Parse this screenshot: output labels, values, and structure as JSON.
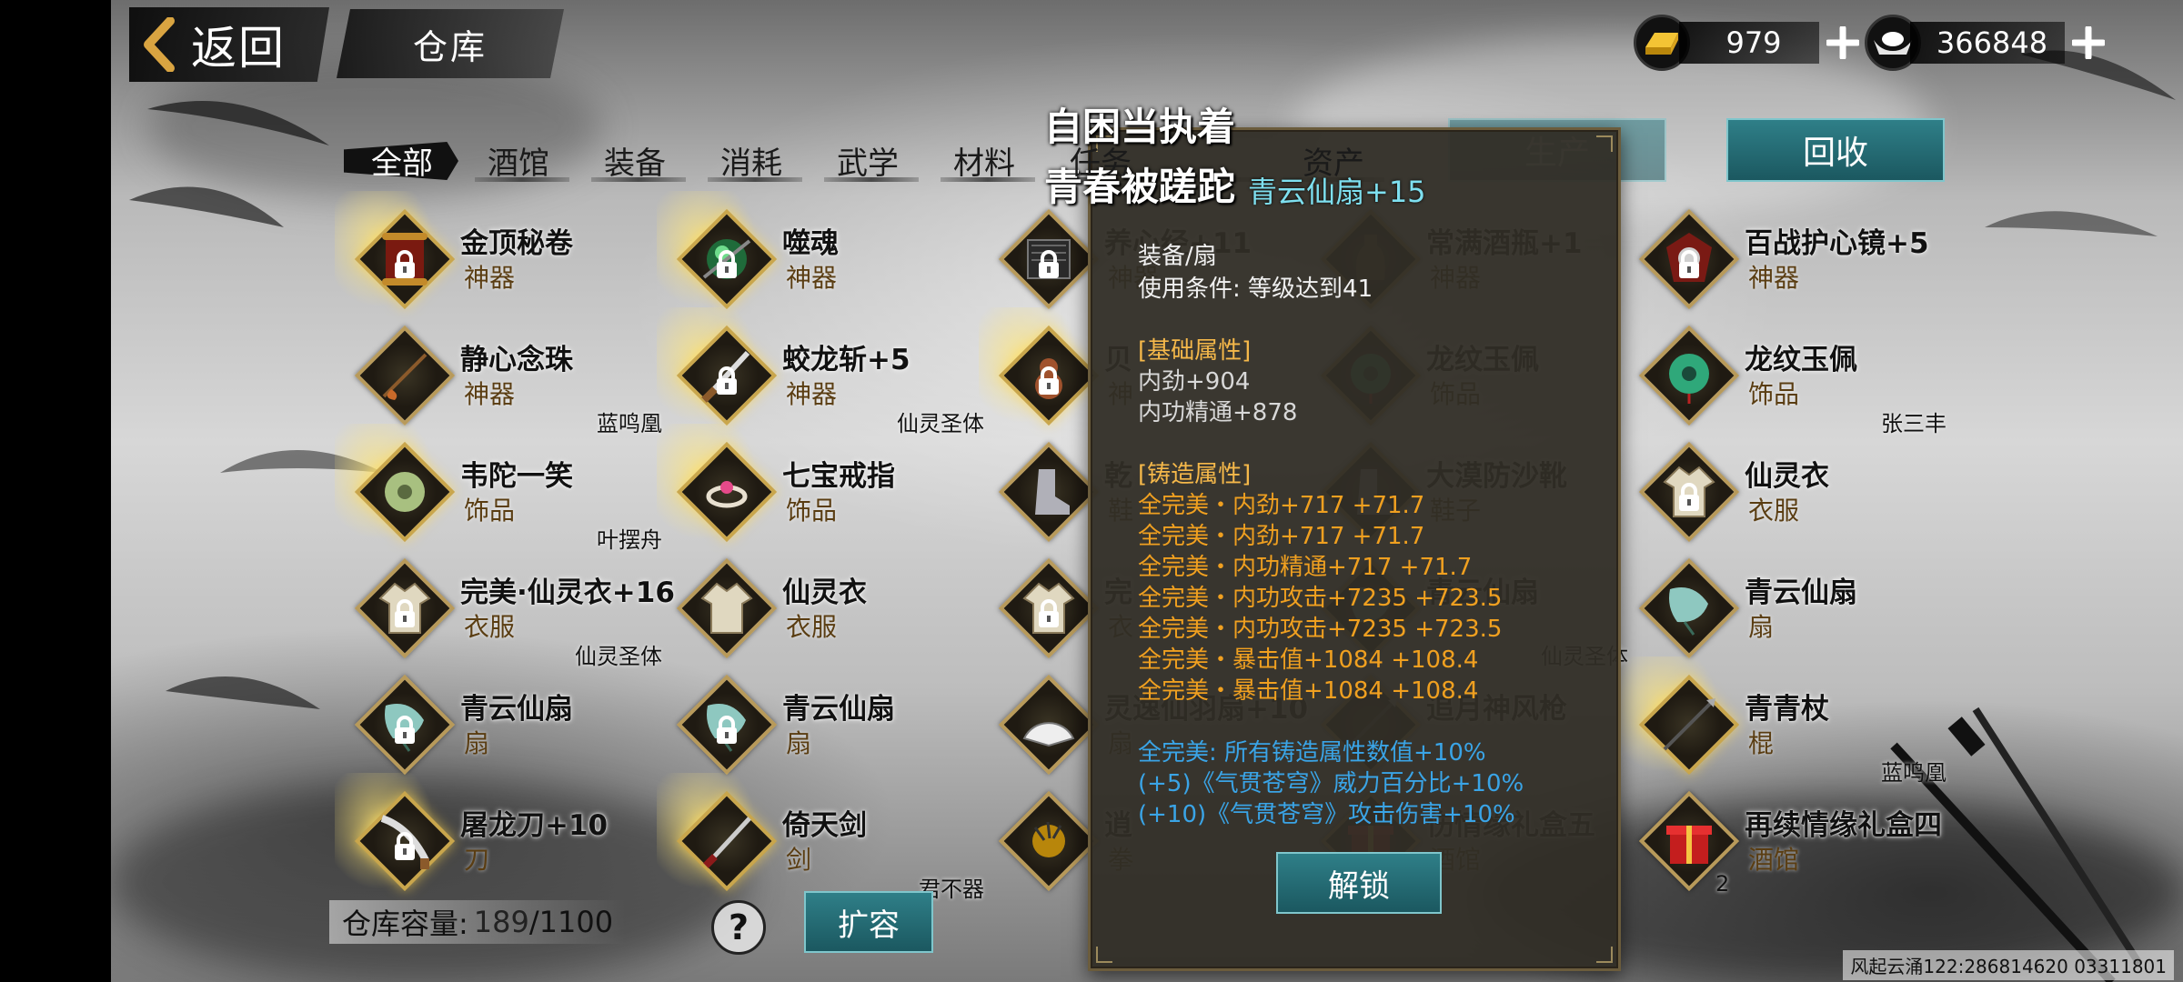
{
  "header": {
    "back_label": "返回",
    "page_title": "仓库",
    "gold": {
      "value": "979"
    },
    "silver": {
      "value": "366848"
    }
  },
  "tabs": [
    {
      "label": "全部",
      "active": true
    },
    {
      "label": "酒馆"
    },
    {
      "label": "装备"
    },
    {
      "label": "消耗"
    },
    {
      "label": "武学"
    },
    {
      "label": "材料"
    },
    {
      "label": "任务"
    },
    {
      "label": ""
    },
    {
      "label": "资产"
    }
  ],
  "buttons": {
    "produce": "生产",
    "recycle": "回收",
    "expand": "扩容",
    "unlock": "解锁",
    "help": "?"
  },
  "items": [
    {
      "col": 0,
      "row": 0,
      "name": "金顶秘卷",
      "type": "神器",
      "owner": "",
      "locked": true,
      "glow": true,
      "art": "scroll"
    },
    {
      "col": 1,
      "row": 0,
      "name": "噬魂",
      "type": "神器",
      "owner": "",
      "locked": true,
      "glow": true,
      "art": "orb"
    },
    {
      "col": 2,
      "row": 0,
      "name": "养心经+11",
      "type": "神器",
      "owner": "",
      "locked": true,
      "glow": false,
      "art": "book"
    },
    {
      "col": 3,
      "row": 0,
      "name": "常满酒瓶+1",
      "type": "神器",
      "owner": "",
      "locked": false,
      "glow": false,
      "art": "bottle"
    },
    {
      "col": 4,
      "row": 0,
      "name": "百战护心镜+5",
      "type": "神器",
      "owner": "",
      "locked": true,
      "glow": false,
      "art": "mirror"
    },
    {
      "col": 0,
      "row": 1,
      "name": "静心念珠",
      "type": "神器",
      "owner": "蓝鸣凰",
      "locked": false,
      "glow": false,
      "art": "beads"
    },
    {
      "col": 1,
      "row": 1,
      "name": "蛟龙斩+5",
      "type": "神器",
      "owner": "仙灵圣体",
      "locked": true,
      "glow": true,
      "art": "blade"
    },
    {
      "col": 2,
      "row": 1,
      "name": "贝",
      "type": "神",
      "owner": "",
      "locked": true,
      "glow": true,
      "art": "gourd"
    },
    {
      "col": 3,
      "row": 1,
      "name": "龙纹玉佩",
      "type": "饰品",
      "owner": "",
      "locked": false,
      "glow": false,
      "art": "jade"
    },
    {
      "col": 4,
      "row": 1,
      "name": "龙纹玉佩",
      "type": "饰品",
      "owner": "张三丰",
      "locked": false,
      "glow": false,
      "art": "jade"
    },
    {
      "col": 0,
      "row": 2,
      "name": "韦陀一笑",
      "type": "饰品",
      "owner": "叶摆舟",
      "locked": false,
      "glow": true,
      "art": "jade2"
    },
    {
      "col": 1,
      "row": 2,
      "name": "七宝戒指",
      "type": "饰品",
      "owner": "",
      "locked": false,
      "glow": true,
      "art": "ring"
    },
    {
      "col": 2,
      "row": 2,
      "name": "乾",
      "type": "鞋",
      "owner": "",
      "locked": false,
      "glow": false,
      "art": "boot"
    },
    {
      "col": 3,
      "row": 2,
      "name": "大漠防沙靴",
      "type": "鞋子",
      "owner": "",
      "locked": false,
      "glow": false,
      "art": "boot"
    },
    {
      "col": 4,
      "row": 2,
      "name": "仙灵衣",
      "type": "衣服",
      "owner": "",
      "locked": true,
      "glow": false,
      "art": "robe"
    },
    {
      "col": 0,
      "row": 3,
      "name": "完美·仙灵衣+16",
      "type": "衣服",
      "owner": "仙灵圣体",
      "locked": true,
      "glow": false,
      "art": "robe"
    },
    {
      "col": 1,
      "row": 3,
      "name": "仙灵衣",
      "type": "衣服",
      "owner": "",
      "locked": false,
      "glow": false,
      "art": "robe"
    },
    {
      "col": 2,
      "row": 3,
      "name": "完",
      "type": "衣",
      "owner": "",
      "locked": true,
      "glow": false,
      "art": "robe"
    },
    {
      "col": 3,
      "row": 3,
      "name": "青云仙扇",
      "type": "",
      "owner": "仙灵圣体",
      "locked": false,
      "glow": false,
      "art": "fan"
    },
    {
      "col": 4,
      "row": 3,
      "name": "青云仙扇",
      "type": "扇",
      "owner": "",
      "locked": false,
      "glow": false,
      "art": "fan"
    },
    {
      "col": 0,
      "row": 4,
      "name": "青云仙扇",
      "type": "扇",
      "owner": "",
      "locked": true,
      "glow": false,
      "art": "fan"
    },
    {
      "col": 1,
      "row": 4,
      "name": "青云仙扇",
      "type": "扇",
      "owner": "",
      "locked": true,
      "glow": false,
      "art": "fan"
    },
    {
      "col": 2,
      "row": 4,
      "name": "灵逸仙羽扇+10",
      "type": "扇",
      "owner": "",
      "locked": false,
      "glow": false,
      "art": "fan2"
    },
    {
      "col": 3,
      "row": 4,
      "name": "追月神风枪",
      "type": "",
      "owner": "",
      "locked": false,
      "glow": false,
      "art": "spear"
    },
    {
      "col": 4,
      "row": 4,
      "name": "青青杖",
      "type": "棍",
      "owner": "蓝鸣凰",
      "locked": false,
      "glow": true,
      "art": "spear"
    },
    {
      "col": 0,
      "row": 5,
      "name": "屠龙刀+10",
      "type": "刀",
      "owner": "",
      "locked": true,
      "glow": true,
      "art": "saber"
    },
    {
      "col": 1,
      "row": 5,
      "name": "倚天剑",
      "type": "剑",
      "owner": "君不器",
      "locked": false,
      "glow": true,
      "art": "sword"
    },
    {
      "col": 2,
      "row": 5,
      "name": "逍",
      "type": "拳",
      "owner": "",
      "locked": false,
      "glow": false,
      "art": "claw"
    },
    {
      "col": 3,
      "row": 5,
      "name": "伤情缘礼盒五",
      "type": "酒馆",
      "owner": "",
      "locked": false,
      "glow": false,
      "art": "gift"
    },
    {
      "col": 4,
      "row": 5,
      "name": "再续情缘礼盒四",
      "type": "酒馆",
      "owner": "",
      "count": "2",
      "locked": false,
      "glow": false,
      "art": "gift"
    }
  ],
  "capacity": {
    "label": "仓库容量:",
    "used": "189",
    "total": "/1100"
  },
  "popup": {
    "title": "青云仙扇+15",
    "category": "装备/扇",
    "requirement": "使用条件:   等级达到41",
    "base_header": "[基础属性]",
    "base_attrs": [
      "内劲+904",
      "内功精通+878"
    ],
    "forge_header": "[铸造属性]",
    "forge_attrs": [
      "全完美・内劲+717  +71.7",
      "全完美・内劲+717  +71.7",
      "全完美・内功精通+717  +71.7",
      "全完美・内功攻击+7235  +723.5",
      "全完美・内功攻击+7235  +723.5",
      "全完美・暴击值+1084  +108.4",
      "全完美・暴击值+1084  +108.4"
    ],
    "set_bonus": [
      "全完美: 所有铸造属性数值+10%",
      "(+5)《气贯苍穹》威力百分比+10%",
      "(+10)《气贯苍穹》攻击伤害+10%"
    ]
  },
  "lyrics": [
    "自困当执着",
    "青春被蹉跎"
  ],
  "footer": "风起云涌122:286814620  03311801",
  "colors": {
    "teal": "#2f7f88",
    "gold": "#f5b84a",
    "blue": "#3aa4e6"
  }
}
